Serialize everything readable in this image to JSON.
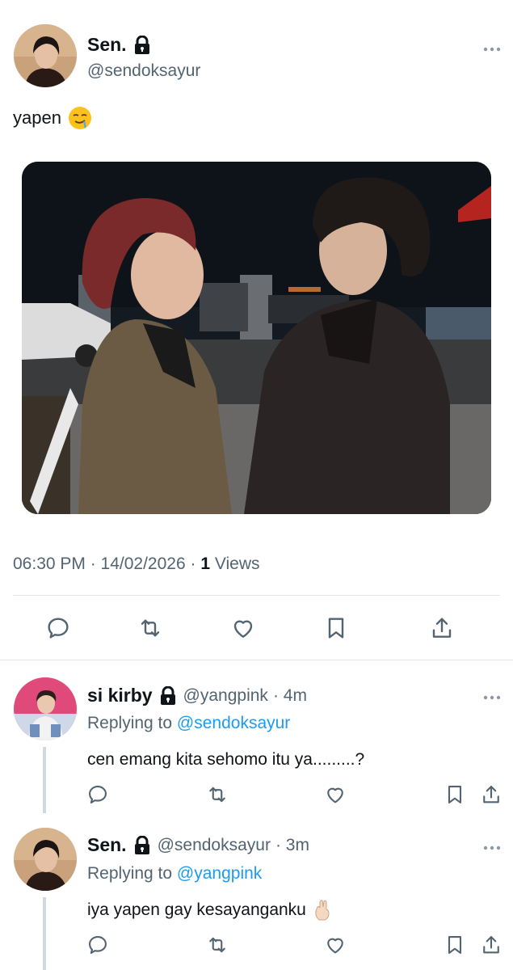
{
  "main_tweet": {
    "display_name": "Sen.",
    "handle": "@sendoksayur",
    "text": "yapen",
    "text_emoji": "relieved-drooling-face-emoji",
    "timestamp": "06:30 PM · 14/02/2026 ·",
    "views_count": "1",
    "views_label": "Views"
  },
  "replies": [
    {
      "display_name": "si kirby",
      "handle": "@yangpink",
      "time": "· 4m",
      "replying_prefix": "Replying to",
      "replying_to": "@sendoksayur",
      "text": "cen emang kita sehomo itu ya.........?"
    },
    {
      "display_name": "Sen.",
      "handle": "@sendoksayur",
      "time": "· 3m",
      "replying_prefix": "Replying to",
      "replying_to": "@yangpink",
      "text": "iya yapen gay kesayanganku",
      "text_emoji": "hand-gesture-emoji"
    }
  ],
  "icons": [
    "lock-icon",
    "more-icon",
    "reply-icon",
    "retweet-icon",
    "like-icon",
    "bookmark-icon",
    "share-icon"
  ],
  "colors": {
    "accent": "#1d9bf0",
    "secondary_text": "#536471",
    "primary_text": "#0f1419",
    "divider": "#e1e6ea"
  }
}
